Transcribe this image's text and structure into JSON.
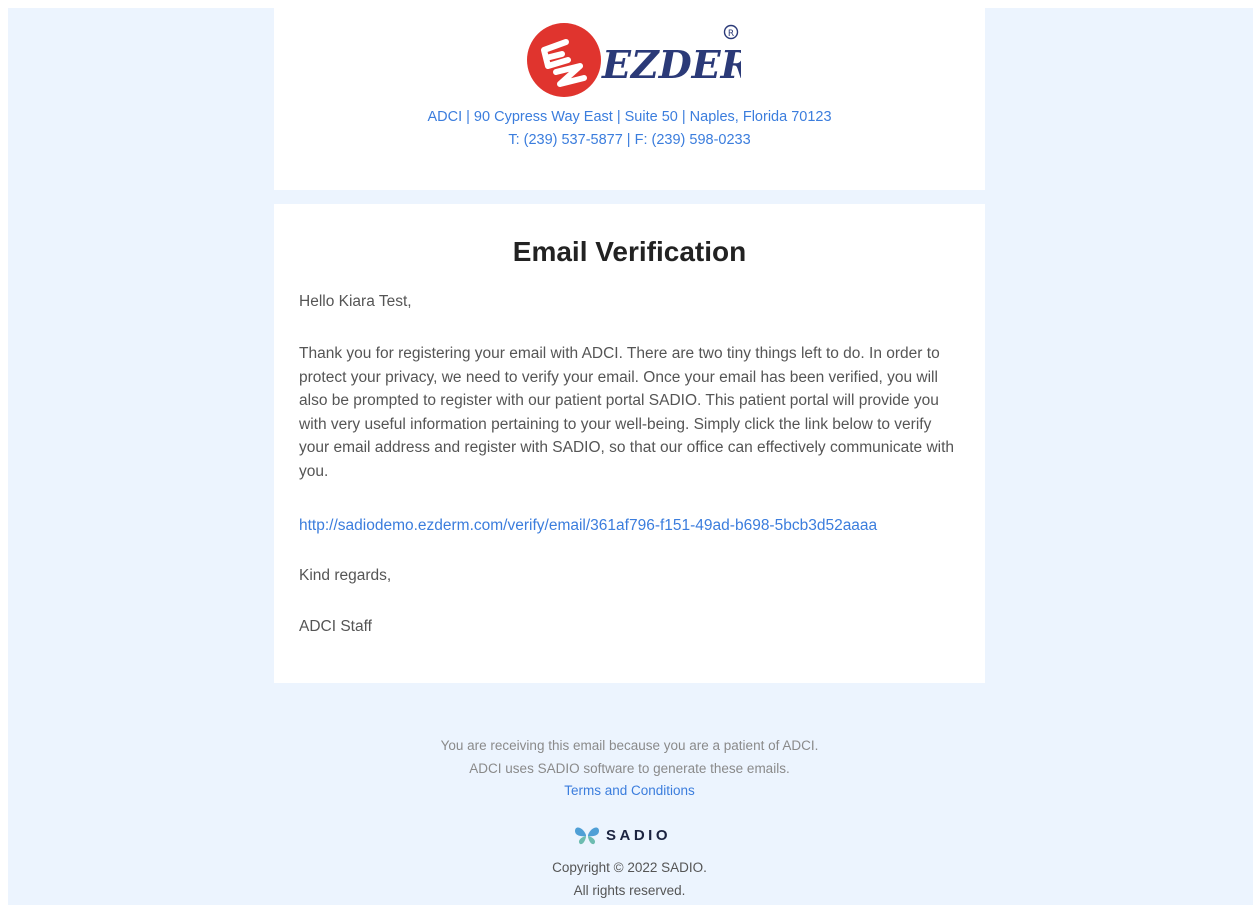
{
  "header": {
    "logo_text": "EZDERM",
    "address_line1": "ADCI | 90 Cypress Way East | Suite 50 | Naples, Florida 70123",
    "address_line2": "T: (239) 537-5877 | F: (239) 598-0233"
  },
  "main": {
    "title": "Email Verification",
    "greeting": "Hello Kiara Test,",
    "paragraph": "Thank you for registering your email with ADCI. There are two tiny things left to do. In order to protect your privacy, we need to verify your email. Once your email has been verified, you will also be prompted to register with our patient portal SADIO. This patient portal will provide you with very useful information pertaining to your well-being. Simply click the link below to verify your email address and register with SADIO, so that our office can effectively communicate with you.",
    "verify_link": "http://sadiodemo.ezderm.com/verify/email/361af796-f151-49ad-b698-5bcb3d52aaaa",
    "regards": "Kind regards,",
    "signoff": "ADCI Staff"
  },
  "footer": {
    "line1": "You are receiving this email because you are a patient of ADCI.",
    "line2": "ADCI uses SADIO software to generate these emails.",
    "terms_label": "Terms and Conditions",
    "brand": "SADIO",
    "copyright": "Copyright © 2022 SADIO.",
    "rights": "All rights reserved."
  },
  "colors": {
    "background": "#ecf4fe",
    "card": "#ffffff",
    "link": "#3b7ddd",
    "logo_red": "#e0342e",
    "logo_navy": "#2b3a78"
  }
}
